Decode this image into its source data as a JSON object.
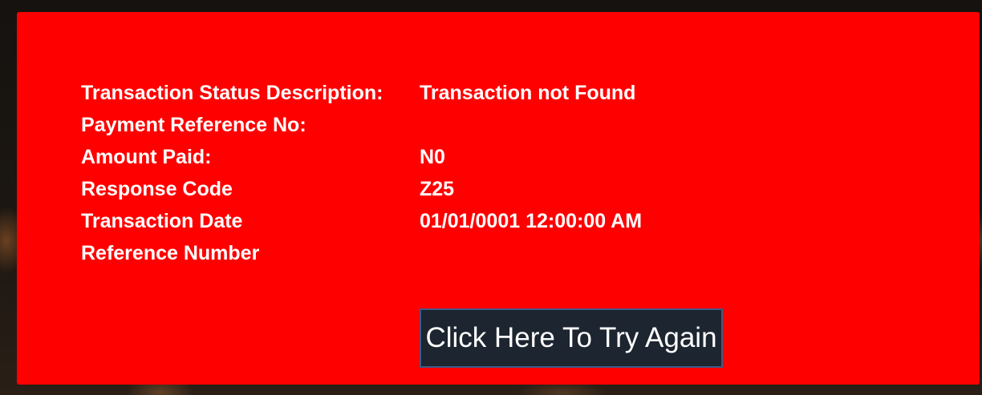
{
  "transaction": {
    "rows": [
      {
        "label": "Transaction Status Description:",
        "value": "Transaction not Found"
      },
      {
        "label": "Payment Reference No:",
        "value": ""
      },
      {
        "label": "Amount Paid:",
        "value": "N0"
      },
      {
        "label": "Response Code",
        "value": "Z25"
      },
      {
        "label": "Transaction Date",
        "value": "01/01/0001 12:00:00 AM"
      },
      {
        "label": "Reference Number",
        "value": ""
      }
    ]
  },
  "actions": {
    "retry_label": "Click Here To Try Again"
  },
  "colors": {
    "panel_background": "#ff0000",
    "button_background": "#1c2530",
    "button_border": "#3f5a86",
    "text": "#ffffff"
  }
}
